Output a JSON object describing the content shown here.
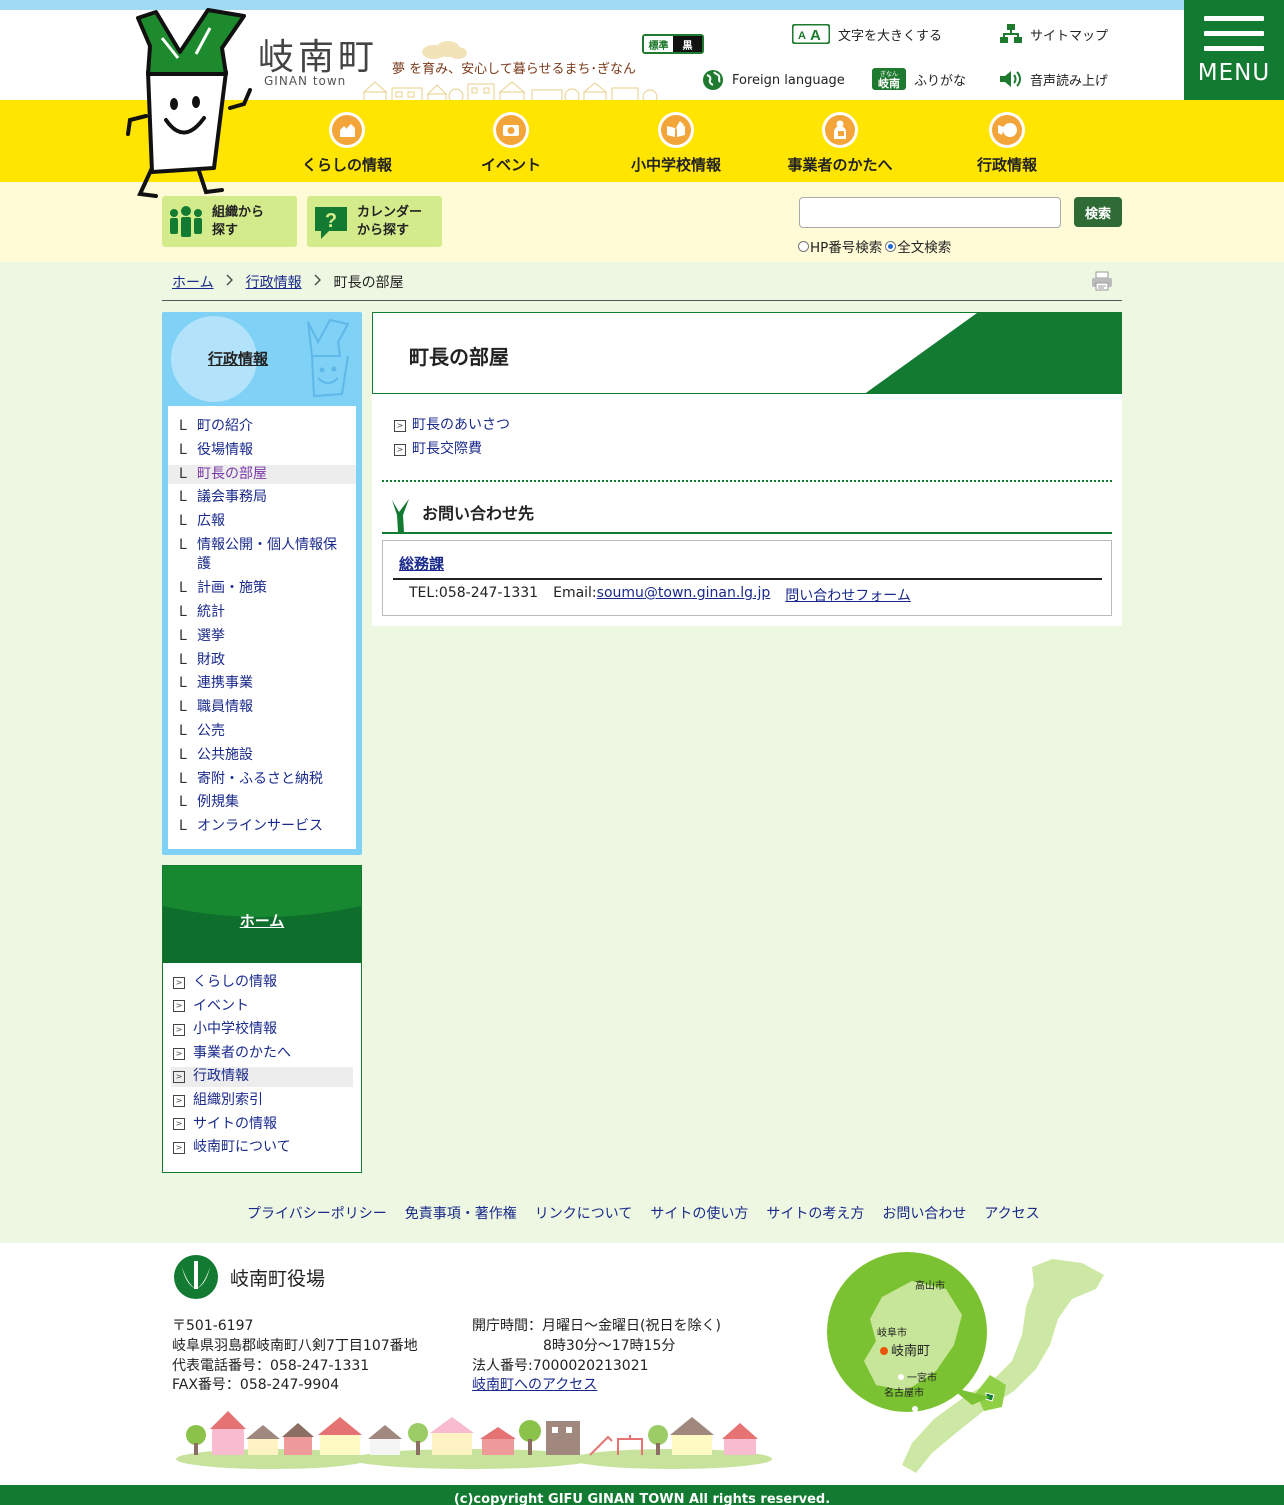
{
  "header": {
    "logo_kanji": "岐南町",
    "logo_roman": "GINAN town",
    "slogan": "夢 を育み、安心して暮らせるまち･ぎなん",
    "contrast_standard": "標準",
    "contrast_black": "黒",
    "utilities": {
      "text_size": "文字を大きくする",
      "sitemap": "サイトマップ",
      "foreign": "Foreign language",
      "furigana": "ふりがな",
      "read_aloud": "音声読み上げ"
    },
    "furigana_badge_top": "ぎなん",
    "furigana_badge": "岐南",
    "menu_label": "MENU"
  },
  "gnav": [
    {
      "label": "くらしの情報",
      "icon": "houses-icon"
    },
    {
      "label": "イベント",
      "icon": "camera-icon"
    },
    {
      "label": "小中学校情報",
      "icon": "book-pencil-icon"
    },
    {
      "label": "事業者のかたへ",
      "icon": "businessperson-icon"
    },
    {
      "label": "行政情報",
      "icon": "town-hall-icon"
    }
  ],
  "find": {
    "org_line1": "組織から",
    "org_line2": "探す",
    "cal_line1": "カレンダー",
    "cal_line2": "から探す"
  },
  "search": {
    "button": "検索",
    "placeholder": "",
    "opt_hp": "HP番号検索",
    "opt_full": "全文検索",
    "selected": "全文検索"
  },
  "breadcrumb": {
    "home": "ホーム",
    "section": "行政情報",
    "current": "町長の部屋",
    "separator": ">"
  },
  "sidebar": {
    "title": "行政情報",
    "mark": "L",
    "items": [
      "町の紹介",
      "役場情報",
      "町長の部屋",
      "議会事務局",
      "広報",
      "情報公開・個人情報保護",
      "計画・施策",
      "統計",
      "選挙",
      "財政",
      "連携事業",
      "職員情報",
      "公売",
      "公共施設",
      "寄附・ふるさと納税",
      "例規集",
      "オンラインサービス"
    ],
    "current_index": 2
  },
  "sidebar2": {
    "title": "ホーム",
    "items": [
      "くらしの情報",
      "イベント",
      "小中学校情報",
      "事業者のかたへ",
      "行政情報",
      "組織別索引",
      "サイトの情報",
      "岐南町について"
    ],
    "current_index": 4
  },
  "main": {
    "title": "町長の部屋",
    "links": [
      "町長のあいさつ",
      "町長交際費"
    ],
    "contact_heading": "お問い合わせ先",
    "dept": "総務課",
    "tel": "TEL:058-247-1331",
    "email_label": "Email:",
    "email": "soumu@town.ginan.lg.jp",
    "form_link": "問い合わせフォーム"
  },
  "footer_links": [
    "プライバシーポリシー",
    "免責事項・著作権",
    "リンクについて",
    "サイトの使い方",
    "サイトの考え方",
    "お問い合わせ",
    "アクセス"
  ],
  "footer": {
    "office_name": "岐南町役場",
    "postal": "〒501-6197",
    "address": "岐阜県羽島郡岐南町八剣7丁目107番地",
    "phone": "代表電話番号：058-247-1331",
    "fax": "FAX番号：058-247-9904",
    "hours_line1": "開庁時間：月曜日～金曜日(祝日を除く)",
    "hours_line2": "8時30分～17時15分",
    "corp_no": "法人番号:7000020213021",
    "access_link": "岐南町へのアクセス",
    "map_labels": {
      "takayama": "高山市",
      "gifu": "岐阜市",
      "ginan": "岐南町",
      "ichinomiya": "一宮市",
      "nagoya": "名古屋市"
    },
    "copyright": "(c)copyright GIFU GINAN TOWN All rights reserved."
  },
  "colors": {
    "brand_green": "#137a32",
    "nav_yellow": "#ffe500",
    "sky_blue": "#7fd1f5",
    "page_bg": "#edf7e1",
    "link": "#1a2a8c"
  }
}
